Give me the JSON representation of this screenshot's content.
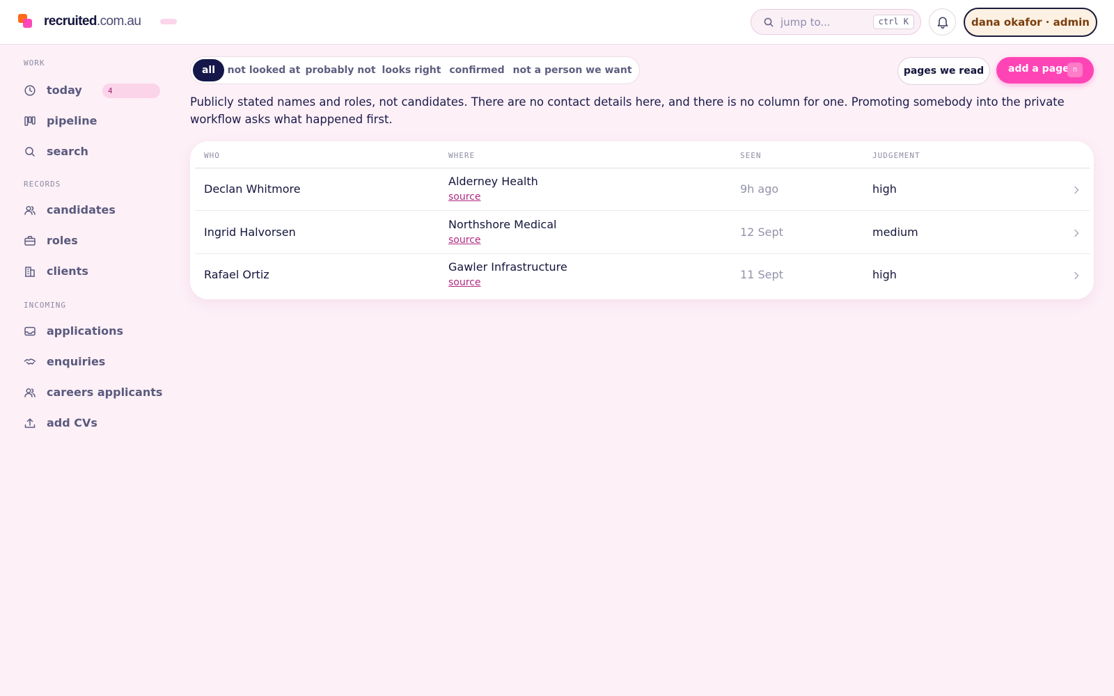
{
  "brand": {
    "name_strong": "recruited",
    "name_light": ".com.au"
  },
  "search": {
    "placeholder": "jump to...",
    "shortcut": "ctrl K"
  },
  "user": {
    "label": "dana okafor · admin"
  },
  "sidebar": {
    "sections": [
      {
        "label": "WORK",
        "items": [
          {
            "label": "today",
            "icon": "clock-icon",
            "badge": "4"
          },
          {
            "label": "pipeline",
            "icon": "columns-icon"
          },
          {
            "label": "search",
            "icon": "search-icon"
          }
        ]
      },
      {
        "label": "RECORDS",
        "items": [
          {
            "label": "candidates",
            "icon": "users-icon"
          },
          {
            "label": "roles",
            "icon": "briefcase-icon"
          },
          {
            "label": "clients",
            "icon": "building-icon"
          }
        ]
      },
      {
        "label": "INCOMING",
        "items": [
          {
            "label": "applications",
            "icon": "inbox-icon"
          },
          {
            "label": "enquiries",
            "icon": "handshake-icon"
          },
          {
            "label": "careers applicants",
            "icon": "users-icon"
          },
          {
            "label": "add CVs",
            "icon": "upload-icon"
          }
        ]
      }
    ]
  },
  "filters": {
    "tabs": [
      "all",
      "not looked at",
      "probably not",
      "looks right",
      "confirmed",
      "not a person we want"
    ],
    "active": "all"
  },
  "actions": {
    "pages_label": "pages we read",
    "add_label": "add a page",
    "add_shortcut": "n"
  },
  "intro": "Publicly stated names and roles, not candidates. There are no contact details here, and there is no column for one. Promoting somebody into the private workflow asks what happened first.",
  "table": {
    "columns": [
      "WHO",
      "WHERE",
      "SEEN",
      "JUDGEMENT"
    ],
    "rows": [
      {
        "who": "Declan Whitmore",
        "where": "Alderney Health",
        "link": "source",
        "seen": "9h ago",
        "judgement": "high"
      },
      {
        "who": "Ingrid Halvorsen",
        "where": "Northshore Medical",
        "link": "source",
        "seen": "12 Sept",
        "judgement": "medium"
      },
      {
        "who": "Rafael Ortiz",
        "where": "Gawler Infrastructure",
        "link": "source",
        "seen": "11 Sept",
        "judgement": "high"
      }
    ]
  },
  "colors": {
    "background": "#fdf0f7",
    "accent": "#ff45b6",
    "navy": "#15174a",
    "link": "#b02a82",
    "brand_orange": "#ff6a1a"
  }
}
